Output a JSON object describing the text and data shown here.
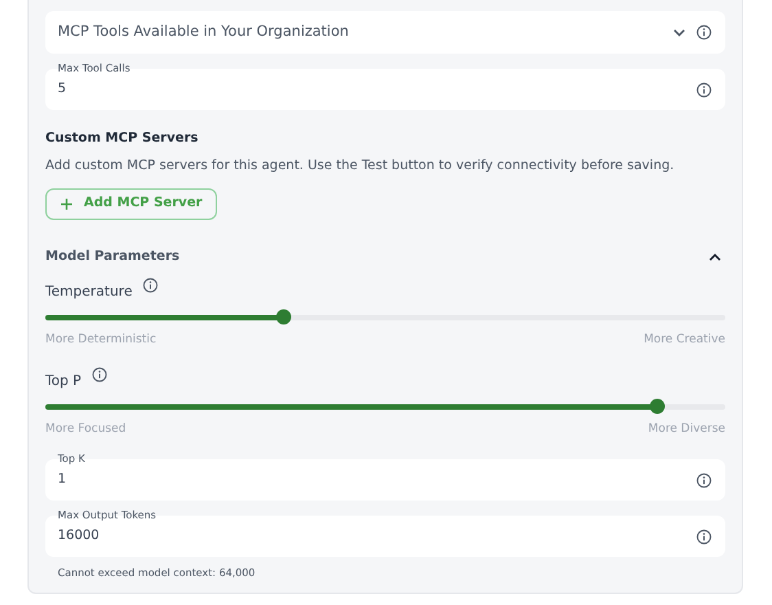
{
  "tools_select": {
    "label": "MCP Tools Available in Your Organization"
  },
  "max_tool_calls": {
    "label": "Max Tool Calls",
    "value": "5"
  },
  "custom_servers": {
    "title": "Custom MCP Servers",
    "description": "Add custom MCP servers for this agent. Use the Test button to verify connectivity before saving.",
    "button": "Add MCP Server"
  },
  "model_parameters": {
    "title": "Model Parameters",
    "expanded": true,
    "sliders": [
      {
        "label": "Temperature",
        "level": 0.35,
        "min_label": "More Deterministic",
        "max_label": "More Creative"
      },
      {
        "label": "Top P",
        "level": 0.9,
        "min_label": "More Focused",
        "max_label": "More Diverse"
      }
    ],
    "fields": [
      {
        "label": "Top K",
        "value": "1"
      },
      {
        "label": "Max Output Tokens",
        "value": "16000",
        "helper": "Cannot exceed model context: 64,000"
      }
    ]
  }
}
